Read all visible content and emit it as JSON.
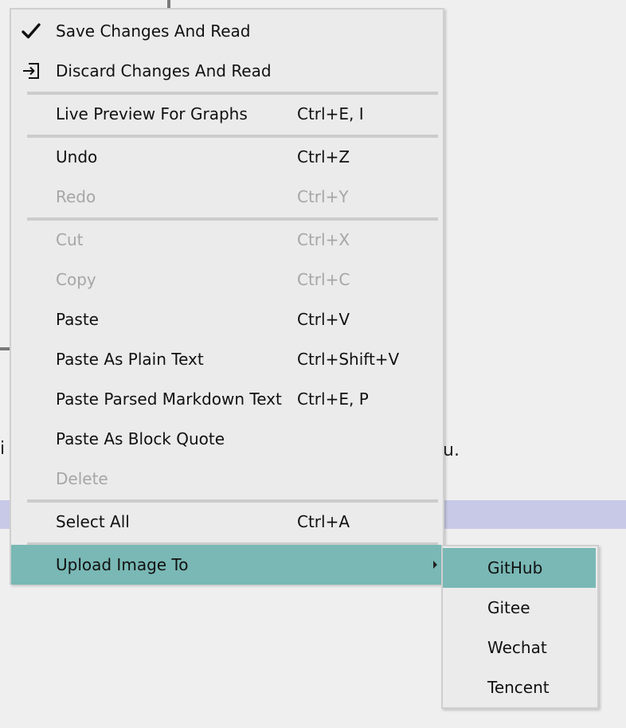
{
  "background": {
    "text_left": "i",
    "text_right": "u."
  },
  "menu": {
    "items": [
      {
        "label": "Save Changes And Read",
        "shortcut": "",
        "icon": "checkmark-icon"
      },
      {
        "label": "Discard Changes And Read",
        "shortcut": "",
        "icon": "discard-icon"
      },
      {
        "label": "Live Preview For Graphs",
        "shortcut": "Ctrl+E, I"
      },
      {
        "label": "Undo",
        "shortcut": "Ctrl+Z"
      },
      {
        "label": "Redo",
        "shortcut": "Ctrl+Y",
        "disabled": true
      },
      {
        "label": "Cut",
        "shortcut": "Ctrl+X",
        "disabled": true
      },
      {
        "label": "Copy",
        "shortcut": "Ctrl+C",
        "disabled": true
      },
      {
        "label": "Paste",
        "shortcut": "Ctrl+V"
      },
      {
        "label": "Paste As Plain Text",
        "shortcut": "Ctrl+Shift+V"
      },
      {
        "label": "Paste Parsed Markdown Text",
        "shortcut": "Ctrl+E, P"
      },
      {
        "label": "Paste As Block Quote",
        "shortcut": ""
      },
      {
        "label": "Delete",
        "shortcut": "",
        "disabled": true
      },
      {
        "label": "Select All",
        "shortcut": "Ctrl+A"
      },
      {
        "label": "Upload Image To",
        "shortcut": "",
        "highlighted": true,
        "submenu": true
      }
    ]
  },
  "submenu": {
    "items": [
      {
        "label": "GitHub",
        "highlighted": true
      },
      {
        "label": "Gitee"
      },
      {
        "label": "Wechat"
      },
      {
        "label": "Tencent"
      }
    ]
  },
  "colors": {
    "highlight": "#79b8b5",
    "menu_bg": "#ebebeb",
    "disabled_text": "#a6a6a6",
    "selection_band": "#c8c9e6"
  }
}
